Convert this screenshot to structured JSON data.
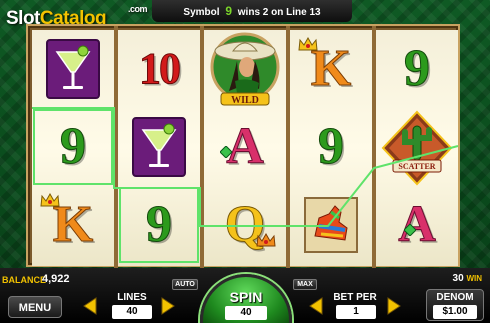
{
  "watermark": {
    "part1": "Slot",
    "part2": "Catalog",
    "suffix": ".com"
  },
  "win_message": {
    "prefix": "Symbol",
    "symbol": "9",
    "suffix": "wins 2 on Line 13"
  },
  "reels": [
    [
      {
        "symbol": "Margarita",
        "icon": "margarita-icon",
        "win": false
      },
      {
        "symbol": "9",
        "icon": "",
        "win": true
      },
      {
        "symbol": "K",
        "icon": "crown-icon",
        "win": false
      }
    ],
    [
      {
        "symbol": "10",
        "icon": "",
        "win": false
      },
      {
        "symbol": "Margarita",
        "icon": "margarita-icon",
        "win": false
      },
      {
        "symbol": "9",
        "icon": "",
        "win": true
      }
    ],
    [
      {
        "symbol": "Wild",
        "icon": "senorita-wild-icon",
        "win": false
      },
      {
        "symbol": "A",
        "icon": "gem-icon",
        "win": false
      },
      {
        "symbol": "Q",
        "icon": "crown-icon",
        "win": false
      }
    ],
    [
      {
        "symbol": "K",
        "icon": "crown-icon",
        "win": false
      },
      {
        "symbol": "9",
        "icon": "",
        "win": false
      },
      {
        "symbol": "Piñata",
        "icon": "pinata-icon",
        "win": false
      }
    ],
    [
      {
        "symbol": "9",
        "icon": "",
        "win": false
      },
      {
        "symbol": "Scatter",
        "icon": "cactus-scatter-icon",
        "win": false
      },
      {
        "symbol": "A",
        "icon": "gem-icon",
        "win": false
      }
    ]
  ],
  "wild_label": "WILD",
  "scatter_label": "SCATTER",
  "balance": {
    "label": "BALANCE",
    "value": "4,922"
  },
  "lines_display": {
    "value": "30",
    "label": "WIN"
  },
  "controls": {
    "menu": "MENU",
    "lines_label": "LINES",
    "lines_value": "40",
    "auto": "AUTO",
    "max": "MAX",
    "spin": "SPIN",
    "spin_value": "40",
    "bet_per_label": "BET PER",
    "bet_per_value": "1",
    "denom_label": "DENOM",
    "denom_value": "$1.00"
  },
  "colors": {
    "win_outline": "#5fe36a",
    "accent": "#f2c200",
    "arrow": "#f2c200",
    "spin": "#1f8a1f"
  }
}
